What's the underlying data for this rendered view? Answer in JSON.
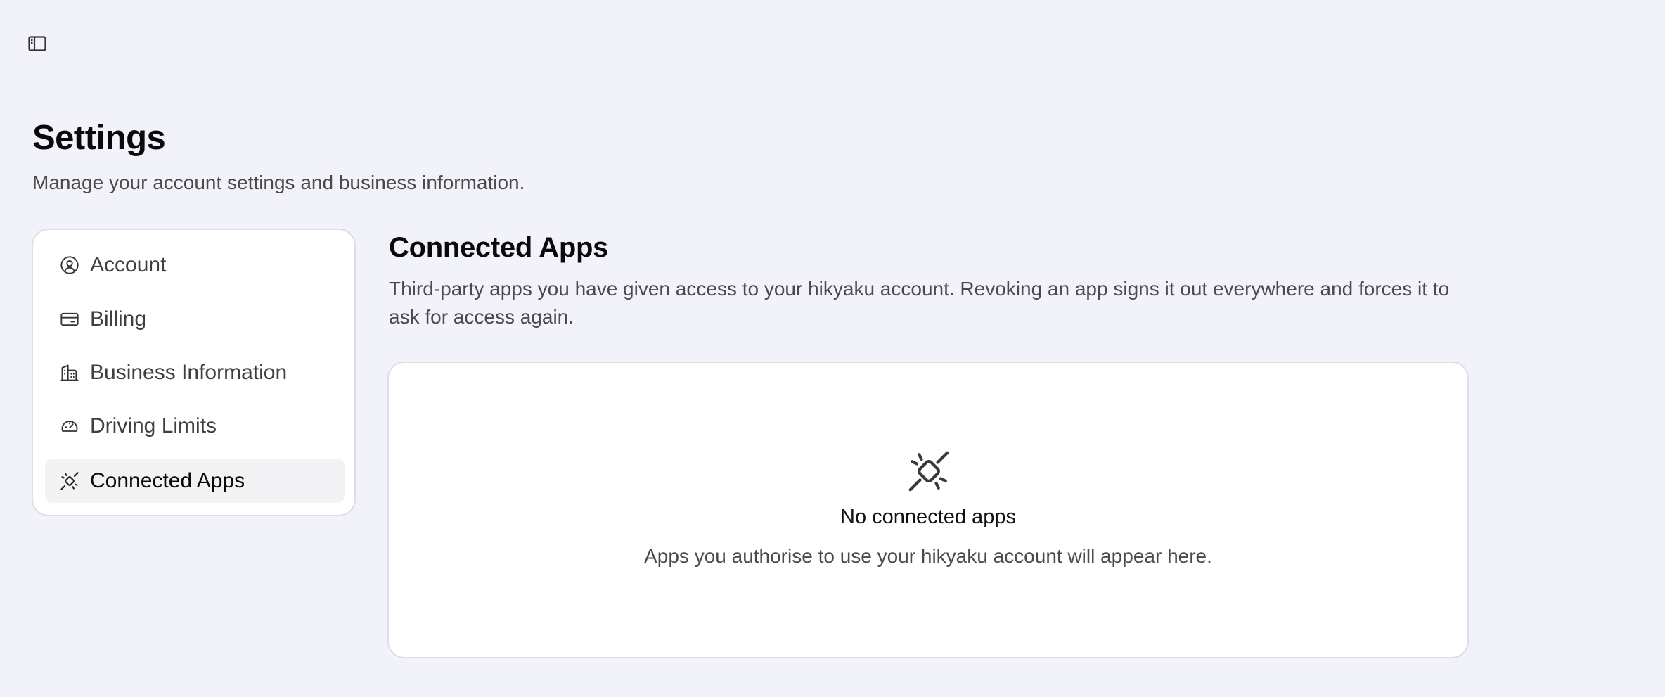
{
  "header": {
    "title": "Settings",
    "subtitle": "Manage your account settings and business information."
  },
  "sidebar_toggle": {
    "icon": "sidebar-toggle-icon"
  },
  "nav": {
    "items": [
      {
        "label": "Account",
        "icon": "user-circle-icon",
        "active": false
      },
      {
        "label": "Billing",
        "icon": "credit-card-icon",
        "active": false
      },
      {
        "label": "Business Information",
        "icon": "building-icon",
        "active": false
      },
      {
        "label": "Driving Limits",
        "icon": "gauge-icon",
        "active": false
      },
      {
        "label": "Connected Apps",
        "icon": "unplug-icon",
        "active": true
      }
    ]
  },
  "section": {
    "title": "Connected Apps",
    "description": "Third-party apps you have given access to your hikyaku account. Revoking an app signs it out everywhere and forces it to ask for access again."
  },
  "empty_state": {
    "icon": "unplug-icon",
    "title": "No connected apps",
    "description": "Apps you authorise to use your hikyaku account will appear here."
  },
  "colors": {
    "background": "#f2f3fa",
    "card": "#ffffff",
    "border": "#dddee6",
    "active_item": "#f3f3f5",
    "text_primary": "#0a0a0a",
    "text_secondary": "#4a4a4a"
  }
}
